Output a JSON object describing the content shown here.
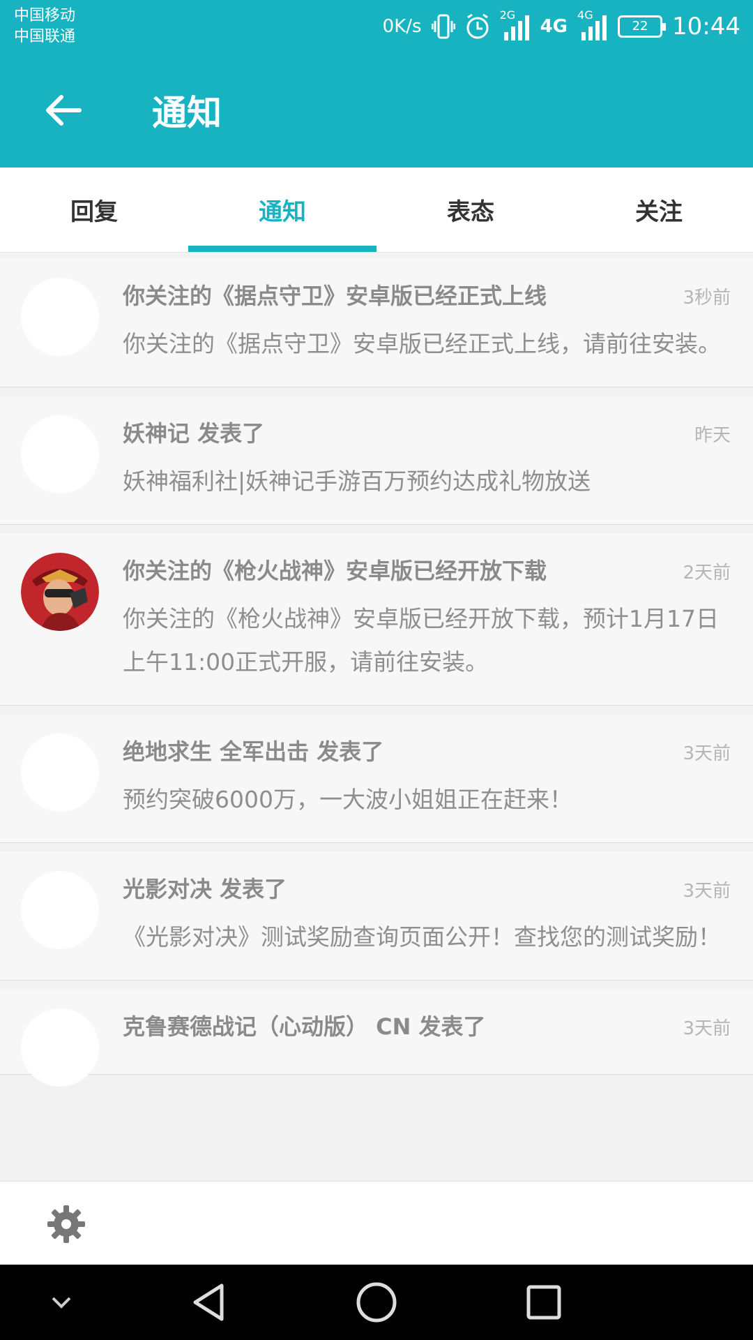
{
  "status_bar": {
    "carrier_1": "中国移动",
    "carrier_2": "中国联通",
    "net_speed": "0K/s",
    "net_2g": "2G",
    "net_4g": "4G",
    "net_4g_2": "4G",
    "battery": "22",
    "time": "10:44"
  },
  "app_bar": {
    "title": "通知",
    "back_icon": "arrow-left-icon"
  },
  "tabs": [
    {
      "label": "回复",
      "active": false
    },
    {
      "label": "通知",
      "active": true
    },
    {
      "label": "表态",
      "active": false
    },
    {
      "label": "关注",
      "active": false
    }
  ],
  "notifications": [
    {
      "title": "你关注的《据点守卫》安卓版已经正式上线",
      "time": "3秒前",
      "body": "你关注的《据点守卫》安卓版已经正式上线，请前往安装。"
    },
    {
      "title": "妖神记 发表了",
      "time": "昨天",
      "body": "妖神福利社|妖神记手游百万预约达成礼物放送"
    },
    {
      "title": "你关注的《枪火战神》安卓版已经开放下载",
      "time": "2天前",
      "body": "你关注的《枪火战神》安卓版已经开放下载，预计1月17日上午11:00正式开服，请前往安装。"
    },
    {
      "title": "绝地求生 全军出击 发表了",
      "time": "3天前",
      "body": "预约突破6000万，一大波小姐姐正在赶来！"
    },
    {
      "title": "光影对决 发表了",
      "time": "3天前",
      "body": "《光影对决》测试奖励查询页面公开！查找您的测试奖励！"
    },
    {
      "title": "克鲁赛德战记（心动版） CN 发表了",
      "time": "3天前",
      "body": ""
    }
  ],
  "toolbar": {
    "settings_icon": "gear-icon"
  },
  "nav_bar": {
    "icons": [
      "chevron-down-icon",
      "back-triangle-icon",
      "home-circle-icon",
      "recents-square-icon"
    ]
  },
  "colors": {
    "accent": "#17b3c1",
    "list_bg": "#f7f7f7",
    "text_muted": "#8a8a8a"
  }
}
